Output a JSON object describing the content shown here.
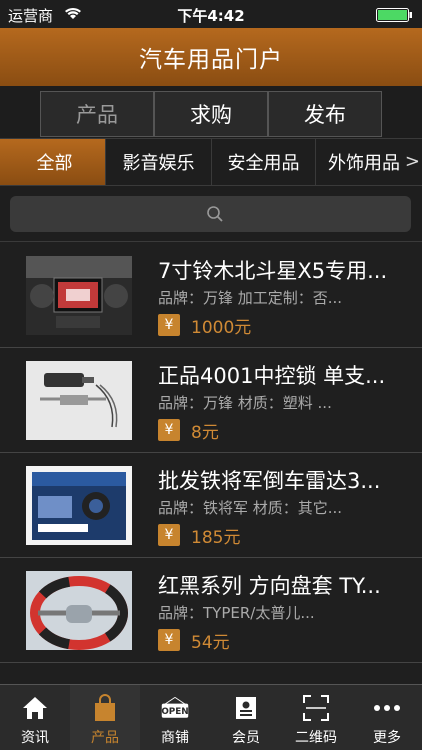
{
  "status": {
    "carrier": "运营商",
    "time": "下午4:42"
  },
  "header": {
    "title": "汽车用品门户"
  },
  "segments": [
    {
      "label": "产品"
    },
    {
      "label": "求购"
    },
    {
      "label": "发布"
    }
  ],
  "categories": {
    "left_arrow": "<",
    "right_arrow": ">",
    "items": [
      {
        "label": "全部"
      },
      {
        "label": "影音娱乐"
      },
      {
        "label": "安全用品"
      },
      {
        "label": "外饰用品"
      }
    ]
  },
  "products": [
    {
      "title": "7寸铃木北斗星X5专用...",
      "meta": "品牌：万锋 加工定制：否...",
      "currency": "¥",
      "price": "1000元"
    },
    {
      "title": "正品4001中控锁 单支...",
      "meta": "品牌：万锋 材质：塑料 ...",
      "currency": "¥",
      "price": "8元"
    },
    {
      "title": "批发铁将军倒车雷达3...",
      "meta": "品牌：铁将军 材质：其它...",
      "currency": "¥",
      "price": "185元"
    },
    {
      "title": "红黑系列 方向盘套 TY...",
      "meta": "品牌：TYPER/太普儿...",
      "currency": "¥",
      "price": "54元"
    }
  ],
  "tabbar": [
    {
      "label": "资讯",
      "icon": "home-icon"
    },
    {
      "label": "产品",
      "icon": "bag-icon"
    },
    {
      "label": "商铺",
      "icon": "open-sign-icon"
    },
    {
      "label": "会员",
      "icon": "member-card-icon"
    },
    {
      "label": "二维码",
      "icon": "qr-scan-icon"
    },
    {
      "label": "更多",
      "icon": "more-icon"
    }
  ],
  "colors": {
    "accent": "#b5691e",
    "price": "#d08a35",
    "background": "#1f1f1f"
  }
}
